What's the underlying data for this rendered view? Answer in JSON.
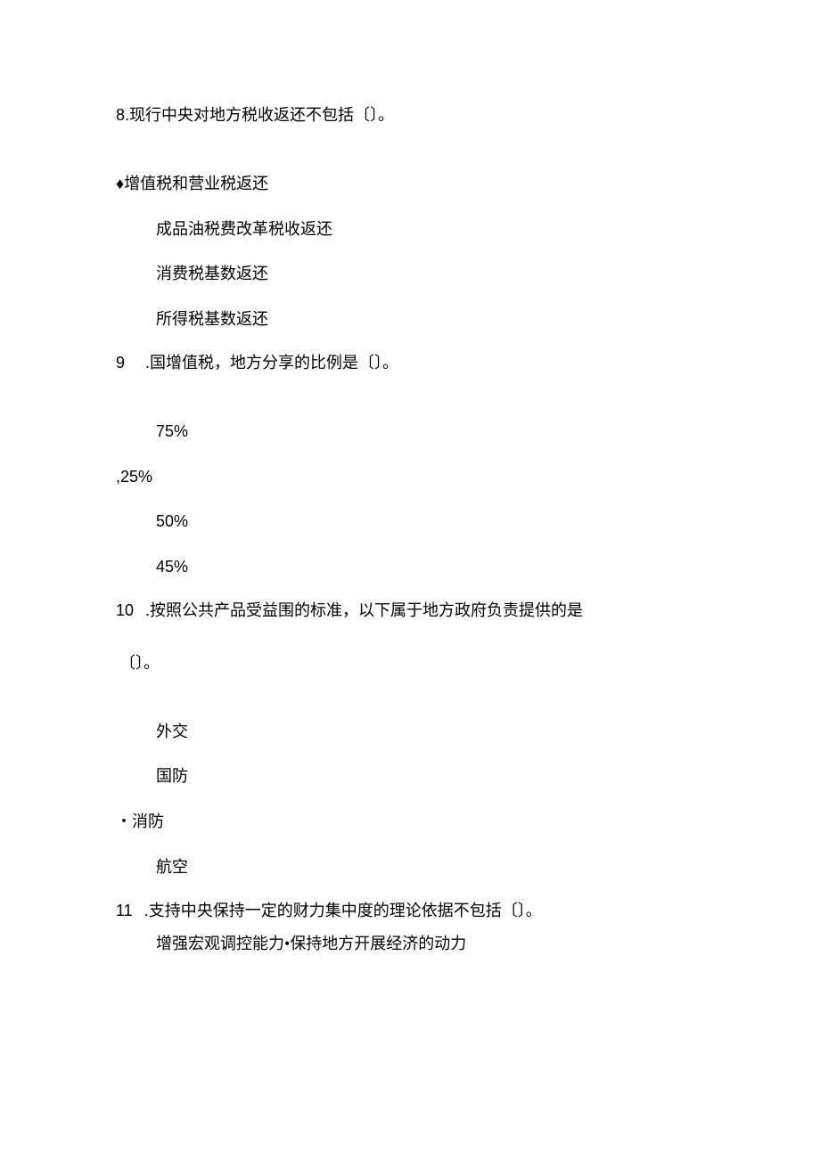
{
  "q8": {
    "number": "8.",
    "text": "现行中央对地方税收返还不包括〔〕。",
    "options": {
      "a": "增值税和营业税返还",
      "b": "成品油税费改革税收返还",
      "c": "消费税基数返还",
      "d": "所得税基数返还"
    }
  },
  "q9": {
    "number": "9",
    "sep": " .",
    "text": "国增值税，地方分享的比例是〔〕。",
    "options": {
      "a": "75%",
      "b_prefix": ",",
      "b": "25%",
      "c": "50%",
      "d": "45%"
    }
  },
  "q10": {
    "number": "10",
    "sep": " .",
    "text": "按照公共产品受益围的标准，以下属于地方政府负责提供的是",
    "text2": "〔〕。",
    "options": {
      "a": "外交",
      "b": "国防",
      "c": "消防",
      "d": "航空"
    }
  },
  "q11": {
    "number": "11",
    "sep": " .",
    "text": "支持中央保持一定的财力集中度的理论依据不包括〔〕。",
    "sub_a": "增强宏观调控能力",
    "sub_b": "保持地方开展经济的动力"
  }
}
